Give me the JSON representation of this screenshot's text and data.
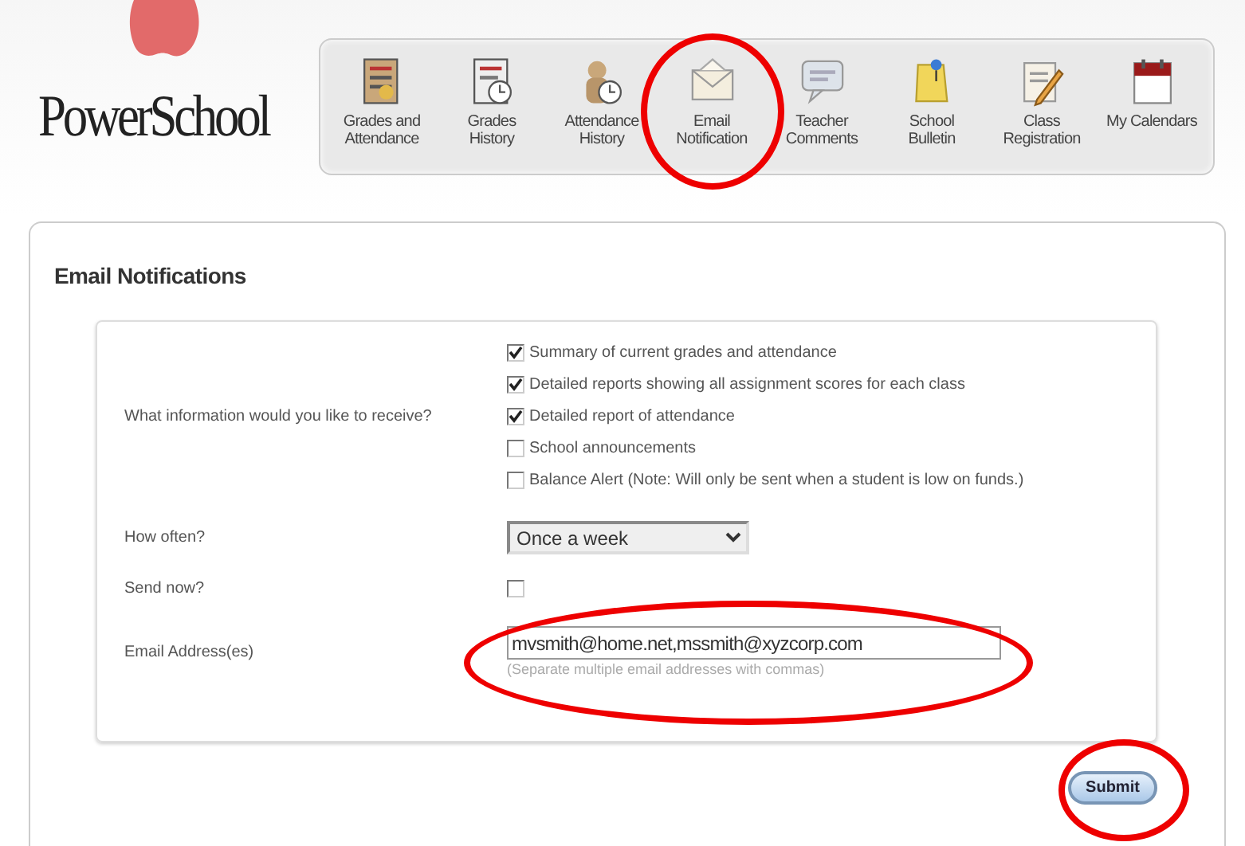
{
  "logo": {
    "text": "PowerSchool"
  },
  "nav": [
    {
      "label": "Grades and Attendance",
      "circled": false
    },
    {
      "label": "Grades History",
      "circled": false
    },
    {
      "label": "Attendance History",
      "circled": false
    },
    {
      "label": "Email Notification",
      "circled": true
    },
    {
      "label": "Teacher Comments",
      "circled": false
    },
    {
      "label": "School Bulletin",
      "circled": false
    },
    {
      "label": "Class Registration",
      "circled": false
    },
    {
      "label": "My Calendars",
      "circled": false
    }
  ],
  "title": "Email Notifications",
  "form": {
    "question": "What information would you like to receive?",
    "options": [
      {
        "label": "Summary of current grades and attendance",
        "checked": true
      },
      {
        "label": "Detailed reports showing all assignment scores for each class",
        "checked": true
      },
      {
        "label": "Detailed report of attendance",
        "checked": true
      },
      {
        "label": "School announcements",
        "checked": false
      },
      {
        "label": "Balance Alert (Note: Will only be sent when a student is low on funds.)",
        "checked": false
      }
    ],
    "frequency": {
      "label": "How often?",
      "value": "Once a week"
    },
    "send_now": {
      "label": "Send now?",
      "checked": false
    },
    "email": {
      "label": "Email Address(es)",
      "value": "mvsmith@home.net,mssmith@xyzcorp.com",
      "hint": "(Separate multiple email addresses with commas)",
      "circled": true
    }
  },
  "submit": {
    "label": "Submit",
    "circled": true
  }
}
